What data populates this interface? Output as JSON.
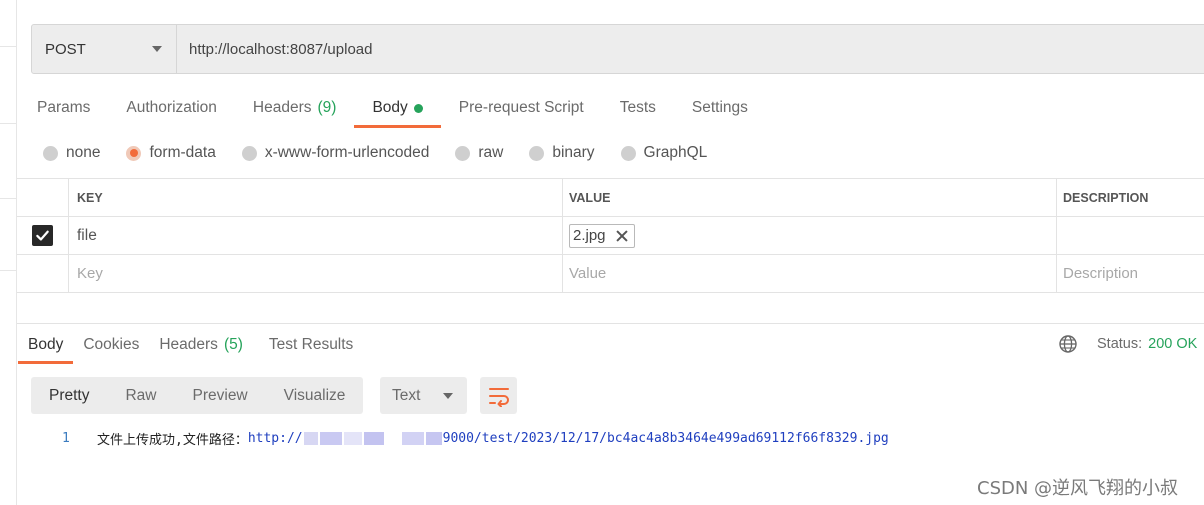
{
  "request": {
    "method": "POST",
    "url": "http://localhost:8087/upload"
  },
  "request_tabs": [
    {
      "label": "Params"
    },
    {
      "label": "Authorization"
    },
    {
      "label": "Headers",
      "count": "(9)"
    },
    {
      "label": "Body"
    },
    {
      "label": "Pre-request Script"
    },
    {
      "label": "Tests"
    },
    {
      "label": "Settings"
    }
  ],
  "body_types": [
    {
      "label": "none"
    },
    {
      "label": "form-data"
    },
    {
      "label": "x-www-form-urlencoded"
    },
    {
      "label": "raw"
    },
    {
      "label": "binary"
    },
    {
      "label": "GraphQL"
    }
  ],
  "kv_table": {
    "headers": {
      "key": "KEY",
      "value": "VALUE",
      "description": "DESCRIPTION"
    },
    "rows": [
      {
        "key": "file",
        "value": "2.jpg"
      }
    ],
    "placeholders": {
      "key": "Key",
      "value": "Value",
      "description": "Description"
    }
  },
  "response_tabs": [
    {
      "label": "Body"
    },
    {
      "label": "Cookies"
    },
    {
      "label": "Headers",
      "count": "(5)"
    },
    {
      "label": "Test Results"
    }
  ],
  "status": {
    "label": "Status:",
    "value": "200 OK"
  },
  "format_buttons": [
    {
      "label": "Pretty"
    },
    {
      "label": "Raw"
    },
    {
      "label": "Preview"
    },
    {
      "label": "Visualize"
    }
  ],
  "content_type": "Text",
  "response_line": {
    "number": "1",
    "text": "文件上传成功,文件路径：",
    "link_start": "http://",
    "link_end": "9000/test/2023/12/17/bc4ac4a8b3464e499ad69112f66f8329.jpg"
  },
  "watermark": "CSDN @逆风飞翔的小叔",
  "colors": {
    "accent": "#f26b3a",
    "success": "#26a35b"
  }
}
